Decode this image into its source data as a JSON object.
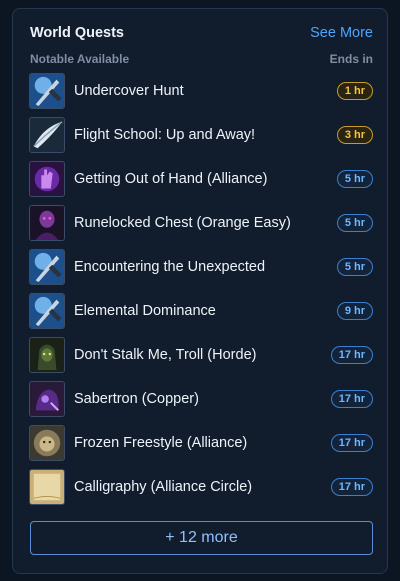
{
  "widget": {
    "title": "World Quests",
    "see_more": "See More",
    "subheader_left": "Notable Available",
    "subheader_right": "Ends in",
    "more_button": "+ 12 more"
  },
  "quests": [
    {
      "name": "Undercover Hunt",
      "ends": "1 hr",
      "urgency": "gold",
      "icon": "spyglass-dagger-icon"
    },
    {
      "name": "Flight School: Up and Away!",
      "ends": "3 hr",
      "urgency": "gold",
      "icon": "feather-wing-icon"
    },
    {
      "name": "Getting Out of Hand (Alliance)",
      "ends": "5 hr",
      "urgency": "blue",
      "icon": "purple-hand-icon"
    },
    {
      "name": "Runelocked Chest (Orange Easy)",
      "ends": "5 hr",
      "urgency": "blue",
      "icon": "purple-character-icon"
    },
    {
      "name": "Encountering the Unexpected",
      "ends": "5 hr",
      "urgency": "blue",
      "icon": "spyglass-dagger-icon"
    },
    {
      "name": "Elemental Dominance",
      "ends": "9 hr",
      "urgency": "blue",
      "icon": "spyglass-dagger-icon"
    },
    {
      "name": "Don't Stalk Me, Troll (Horde)",
      "ends": "17 hr",
      "urgency": "blue",
      "icon": "troll-hunter-icon"
    },
    {
      "name": "Sabertron (Copper)",
      "ends": "17 hr",
      "urgency": "blue",
      "icon": "sabertron-icon"
    },
    {
      "name": "Frozen Freestyle (Alliance)",
      "ends": "17 hr",
      "urgency": "blue",
      "icon": "lion-head-icon"
    },
    {
      "name": "Calligraphy (Alliance Circle)",
      "ends": "17 hr",
      "urgency": "blue",
      "icon": "parchment-scroll-icon"
    }
  ],
  "colors": {
    "accent": "#4fa3ff",
    "urgent": "#f5c542",
    "normal": "#6fb6ff"
  }
}
